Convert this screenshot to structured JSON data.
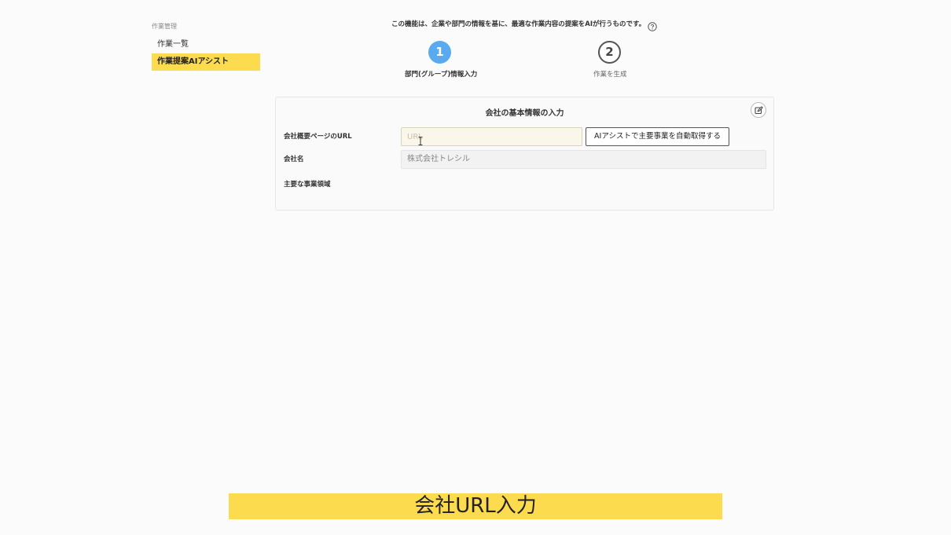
{
  "sidebar": {
    "heading": "作業管理",
    "items": [
      {
        "label": "作業一覧",
        "active": false
      },
      {
        "label": "作業提案AIアシスト",
        "active": true
      }
    ]
  },
  "intro": {
    "text": "この機能は、企業や部門の情報を基に、最適な作業内容の提案をAIが行うものです。",
    "help_icon": "question-circle-icon"
  },
  "steps": [
    {
      "number": "1",
      "label": "部門(グループ)情報入力",
      "active": true
    },
    {
      "number": "2",
      "label": "作業を生成",
      "active": false
    }
  ],
  "card": {
    "title": "会社の基本情報の入力",
    "edit_icon": "edit-icon",
    "fields": {
      "url": {
        "label": "会社概要ページのURL",
        "placeholder": "URL",
        "value": ""
      },
      "company_name": {
        "label": "会社名",
        "value": "株式会社トレシル"
      },
      "business_areas": {
        "label": "主要な事業領域"
      }
    },
    "ai_button_label": "AIアシストで主要事業を自動取得する"
  },
  "caption": "会社URL入力",
  "colors": {
    "accent_yellow": "#fddb4e",
    "step_active_blue": "#5aaaf0",
    "background": "#fbfbfb"
  }
}
